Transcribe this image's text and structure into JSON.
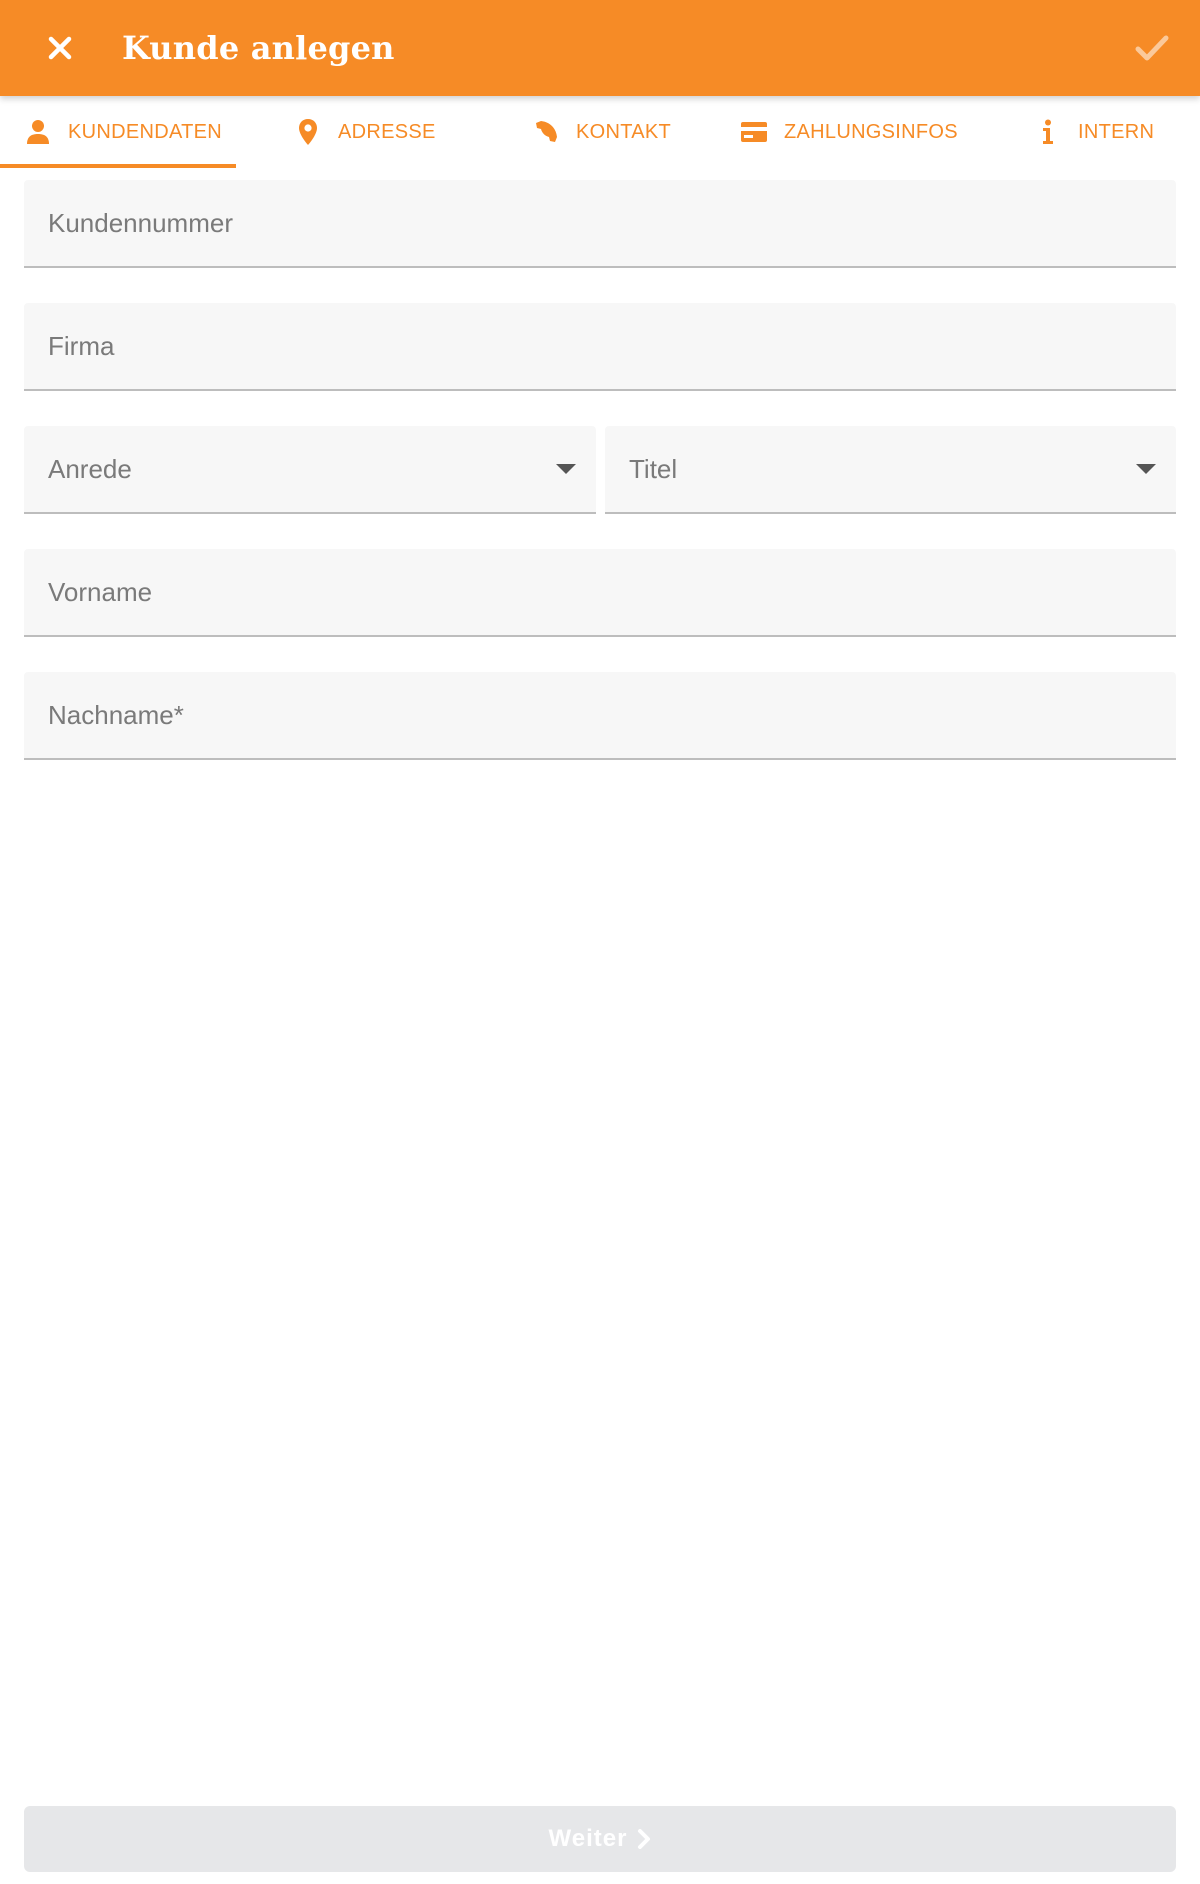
{
  "appbar": {
    "title": "Kunde anlegen",
    "close_icon": "close-icon",
    "confirm_icon": "check-icon",
    "background": "#f68b26"
  },
  "tabs": [
    {
      "label": "KUNDENDATEN",
      "icon": "person-icon",
      "active": true
    },
    {
      "label": "ADRESSE",
      "icon": "location-pin-icon",
      "active": false
    },
    {
      "label": "KONTAKT",
      "icon": "phone-icon",
      "active": false
    },
    {
      "label": "ZAHLUNGSINFOS",
      "icon": "credit-card-icon",
      "active": false
    },
    {
      "label": "INTERN",
      "icon": "info-icon",
      "active": false
    }
  ],
  "form": {
    "kundennummer": {
      "placeholder": "Kundennummer",
      "value": ""
    },
    "firma": {
      "placeholder": "Firma",
      "value": ""
    },
    "anrede": {
      "placeholder": "Anrede",
      "value": ""
    },
    "titel": {
      "placeholder": "Titel",
      "value": ""
    },
    "vorname": {
      "placeholder": "Vorname",
      "value": ""
    },
    "nachname": {
      "placeholder": "Nachname*",
      "value": ""
    }
  },
  "footer": {
    "next_label": "Weiter",
    "next_icon": "chevron-right-icon"
  },
  "colors": {
    "accent": "#f68b26",
    "field_bg": "#f7f7f7",
    "disabled_button": "#e6e7e9"
  }
}
